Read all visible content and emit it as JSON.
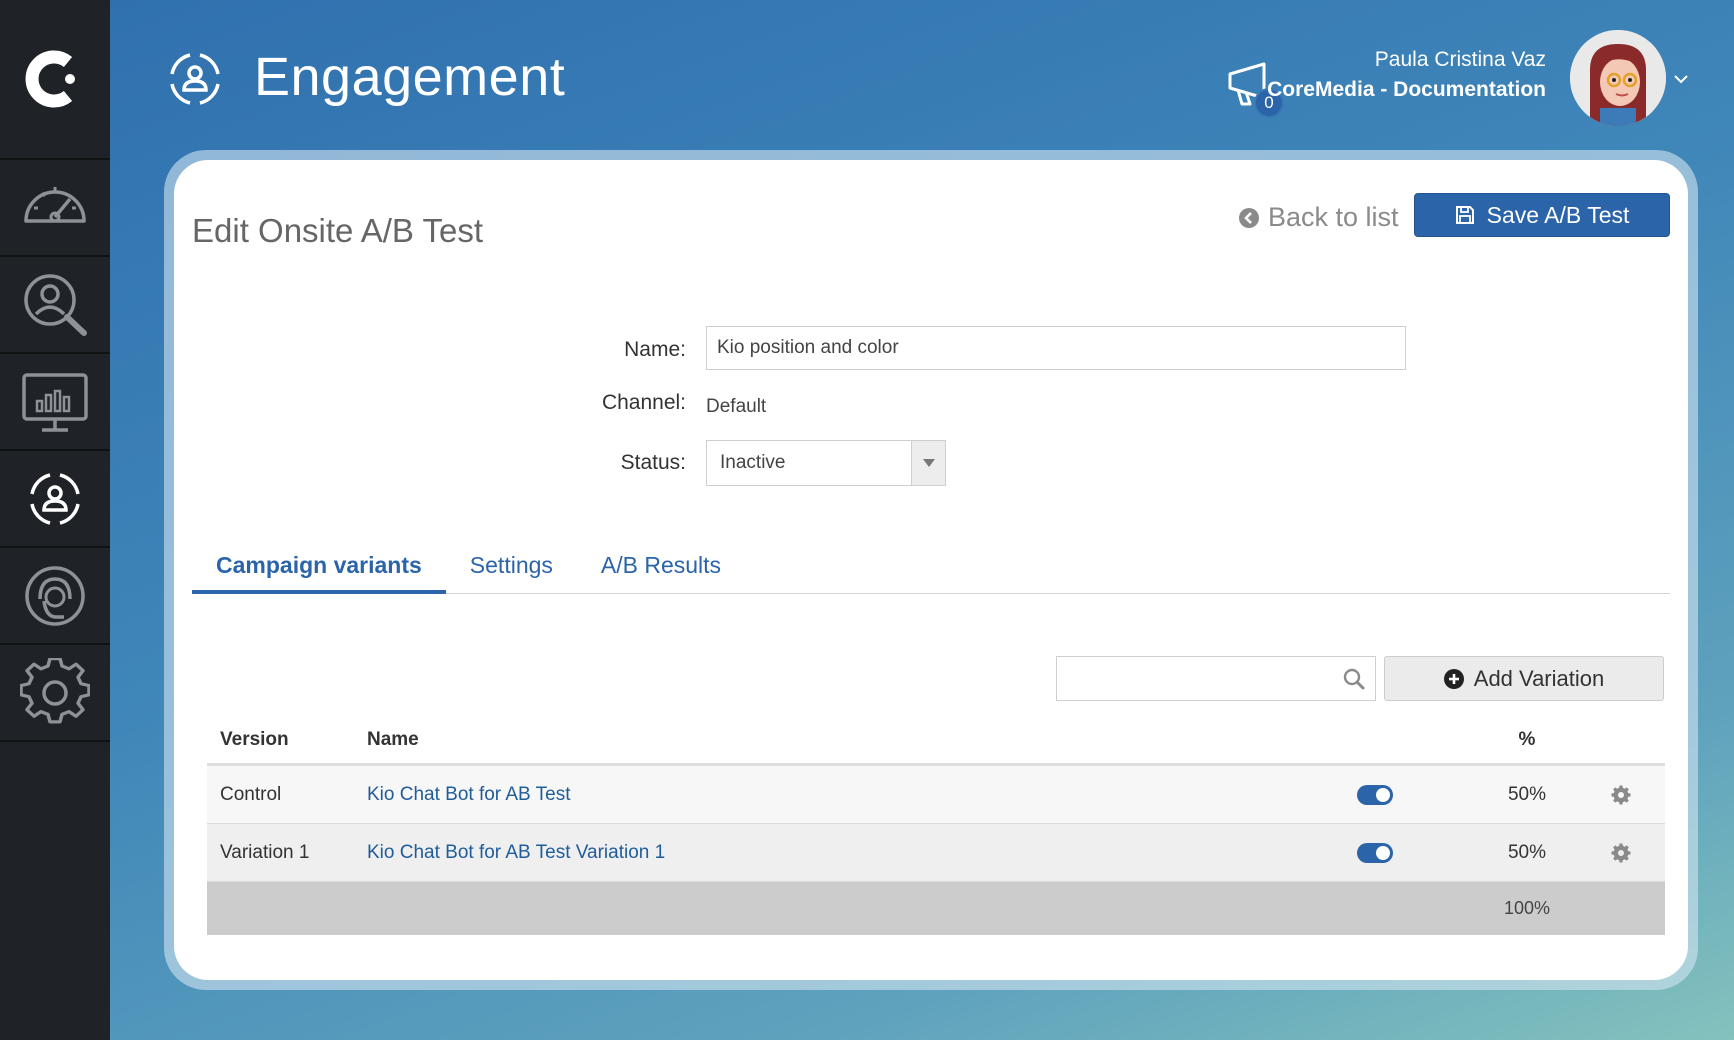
{
  "app": {
    "title": "Engagement"
  },
  "user": {
    "name": "Paula Cristina Vaz",
    "org": "CoreMedia - Documentation",
    "notifications": "0"
  },
  "page": {
    "heading": "Edit Onsite A/B Test",
    "back_label": "Back to list",
    "save_label": "Save A/B Test"
  },
  "form": {
    "name_label": "Name:",
    "name_value": "Kio position and color",
    "channel_label": "Channel:",
    "channel_value": "Default",
    "status_label": "Status:",
    "status_value": "Inactive"
  },
  "tabs": [
    {
      "label": "Campaign variants",
      "active": true
    },
    {
      "label": "Settings",
      "active": false
    },
    {
      "label": "A/B Results",
      "active": false
    }
  ],
  "toolbar": {
    "search_placeholder": "",
    "add_label": "Add Variation"
  },
  "table": {
    "headers": {
      "version": "Version",
      "name": "Name",
      "percent": "%"
    },
    "rows": [
      {
        "version": "Control",
        "name": "Kio Chat Bot for AB Test",
        "enabled": true,
        "percent": "50%"
      },
      {
        "version": "Variation 1",
        "name": "Kio Chat Bot for AB Test Variation 1",
        "enabled": true,
        "percent": "50%"
      }
    ],
    "total": "100%"
  },
  "colors": {
    "primary": "#2b64a8",
    "sidebar": "#1f2327"
  },
  "icons": {
    "sidebar": [
      "dashboard-gauge-icon",
      "audience-search-icon",
      "analytics-monitor-icon",
      "engagement-icon",
      "support-agent-icon",
      "settings-gear-icon"
    ]
  }
}
